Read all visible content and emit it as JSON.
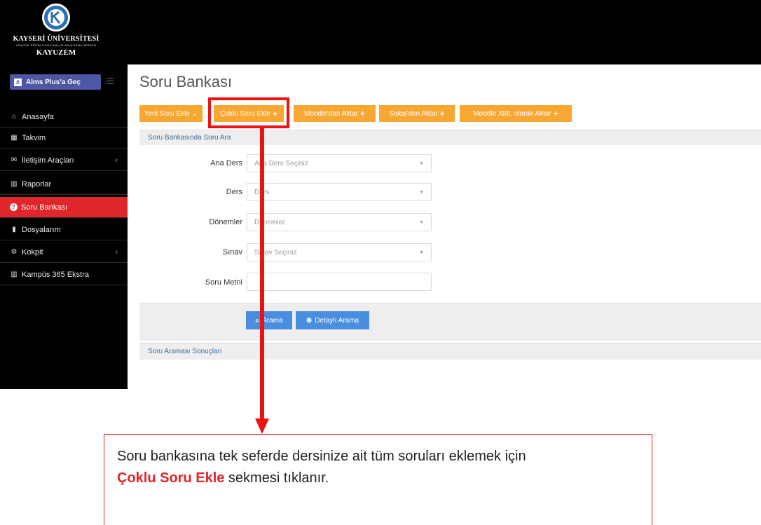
{
  "header": {
    "logo_university": "KAYSERİ ÜNİVERSİTESİ",
    "logo_small": "UZAKTAN EĞİTİM UYGULAMA VE ARAŞTIRMA MERKEZİ",
    "logo_center": "KAYUZEM"
  },
  "sidebar": {
    "alms_button": "Alms Plus'a Geç",
    "items": [
      {
        "label": "Anasayfa",
        "icon": "home-icon",
        "glyph": "⌂"
      },
      {
        "label": "Takvim",
        "icon": "calendar-icon",
        "glyph": "▦"
      },
      {
        "label": "İletişim Araçları",
        "icon": "envelope-icon",
        "glyph": "✉",
        "chevron": "‹"
      },
      {
        "label": "Raporlar",
        "icon": "chart-icon",
        "glyph": "▥"
      },
      {
        "label": "Soru Bankası",
        "icon": "question-icon",
        "glyph": "?",
        "active": true
      },
      {
        "label": "Dosyalarım",
        "icon": "file-icon",
        "glyph": "▮"
      },
      {
        "label": "Kokpit",
        "icon": "cogs-icon",
        "glyph": "⚙",
        "chevron": "‹"
      },
      {
        "label": "Kampüs 365 Ekstra",
        "icon": "chart-icon",
        "glyph": "▥"
      }
    ]
  },
  "page": {
    "title": "Soru Bankası"
  },
  "toolbar": {
    "yeni_soru": "Yeni Soru Ekle",
    "yeni_soru_caret": "⌄",
    "coklu_soru": "Çoklu Soru Ekle",
    "moodle": "Moodle'dan Aktar",
    "sakai": "Sakai'den Aktar",
    "moodle_xml": "Moodle XML olarak Aktar",
    "plus": "+"
  },
  "search": {
    "section_title": "Soru Bankasında Soru Ara",
    "fields": [
      {
        "label": "Ana Ders",
        "placeholder": "Ana Ders Seçiniz"
      },
      {
        "label": "Ders",
        "placeholder": "Ders"
      },
      {
        "label": "Dönemler",
        "placeholder": "Dönemler"
      },
      {
        "label": "Sınav",
        "placeholder": "Sınav Seçiniz"
      }
    ],
    "text_label": "Soru Metni",
    "text_value": "",
    "search_button": "Arama",
    "detailed_button": "Detaylı Arama",
    "results_title": "Soru Araması Sonuçları"
  },
  "callout": {
    "text_before": "Soru bankasına tek seferde dersinize ait tüm soruları eklemek için",
    "highlight": "Çoklu Soru Ekle",
    "text_after": " sekmesi tıklanır."
  },
  "colors": {
    "active_red": "#e0262a",
    "toolbar_orange": "#f8a832",
    "button_blue": "#4a8ee0",
    "alms_purple": "#4e56a6"
  }
}
